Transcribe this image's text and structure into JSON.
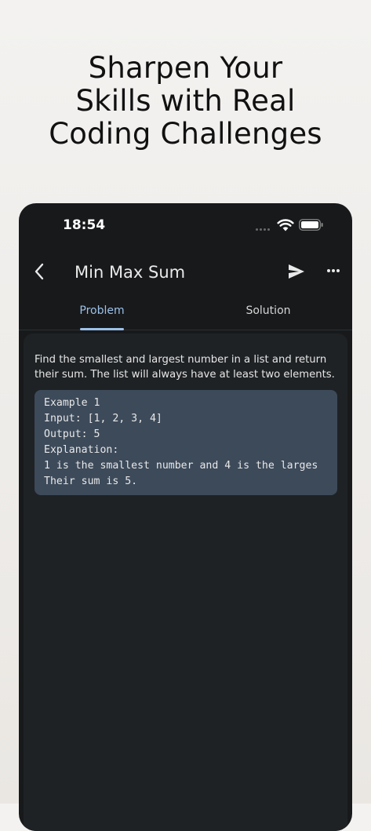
{
  "headline": {
    "line1": "Sharpen Your",
    "line2": "Skills with Real",
    "line3": "Coding Challenges"
  },
  "status_bar": {
    "time": "18:54",
    "icons": [
      "signal-dots-icon",
      "wifi-icon",
      "battery-icon"
    ]
  },
  "app_bar": {
    "title": "Min Max Sum",
    "icons": [
      "back-chevron-icon",
      "send-icon",
      "more-horizontal-icon"
    ]
  },
  "tabs": [
    {
      "label": "Problem",
      "selected": true
    },
    {
      "label": "Solution",
      "selected": false
    }
  ],
  "problem": {
    "description": "Find the smallest and largest number in a list and return their sum. The list will always have at least two elements.",
    "example_lines": [
      "Example 1",
      "Input: [1, 2, 3, 4]",
      "Output: 5",
      "Explanation:",
      "1 is the smallest number and 4 is the larges",
      "Their sum is 5."
    ]
  },
  "colors": {
    "page_background": "#f3f2f0",
    "phone_background": "#17191b",
    "card_background": "#1f2225",
    "example_background": "#3d4a5a",
    "accent": "#9dc1e8"
  }
}
